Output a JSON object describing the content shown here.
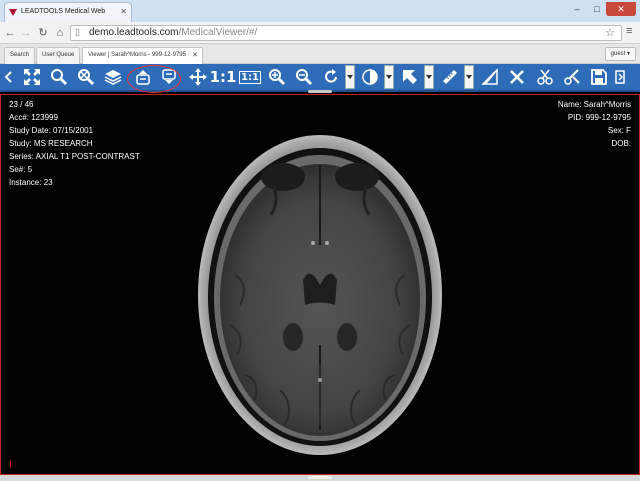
{
  "browser": {
    "tab_title": "LEADTOOLS Medical Web",
    "url_host": "demo.leadtools.com",
    "url_path": "/MedicalViewer/#/"
  },
  "app_tabs": {
    "search": "Search",
    "user_queue": "User Queue",
    "viewer": "Viewer | Sarah^Morris - 999-12-9795",
    "guest": "guest ▾"
  },
  "toolbar": {
    "icons": [
      "collapse-left",
      "fit-image",
      "zoom",
      "magnify-glass",
      "stack",
      "series-up",
      "series-down",
      "move",
      "actual-size",
      "fit-1to1",
      "zoom-in",
      "zoom-out",
      "rotate",
      "window-level",
      "select-pointer",
      "ruler",
      "cobb-angle",
      "cut",
      "scissors",
      "clear",
      "save",
      "more"
    ],
    "text_buttons": {
      "one_to_one": "1:1",
      "fit_one": "1:1"
    },
    "accent_color": "#2f6cb8",
    "highlight_color": "#e33333"
  },
  "overlay": {
    "left": {
      "frame": "23 / 46",
      "accession": "Acc#: 123999",
      "study_date": "Study Date: 07/15/2001",
      "study": "Study: MS RESEARCH",
      "series": "Series: AXIAL T1 POST-CONTRAST",
      "series_number": "Se#: 5",
      "instance": "Instance: 23"
    },
    "right": {
      "name": "Name: Sarah^Morris",
      "pid": "PID: 999-12-9795",
      "sex": "Sex: F",
      "dob": "DOB:"
    }
  },
  "viewer": {
    "border_color": "#c9211e",
    "image_type": "axial brain MRI"
  }
}
